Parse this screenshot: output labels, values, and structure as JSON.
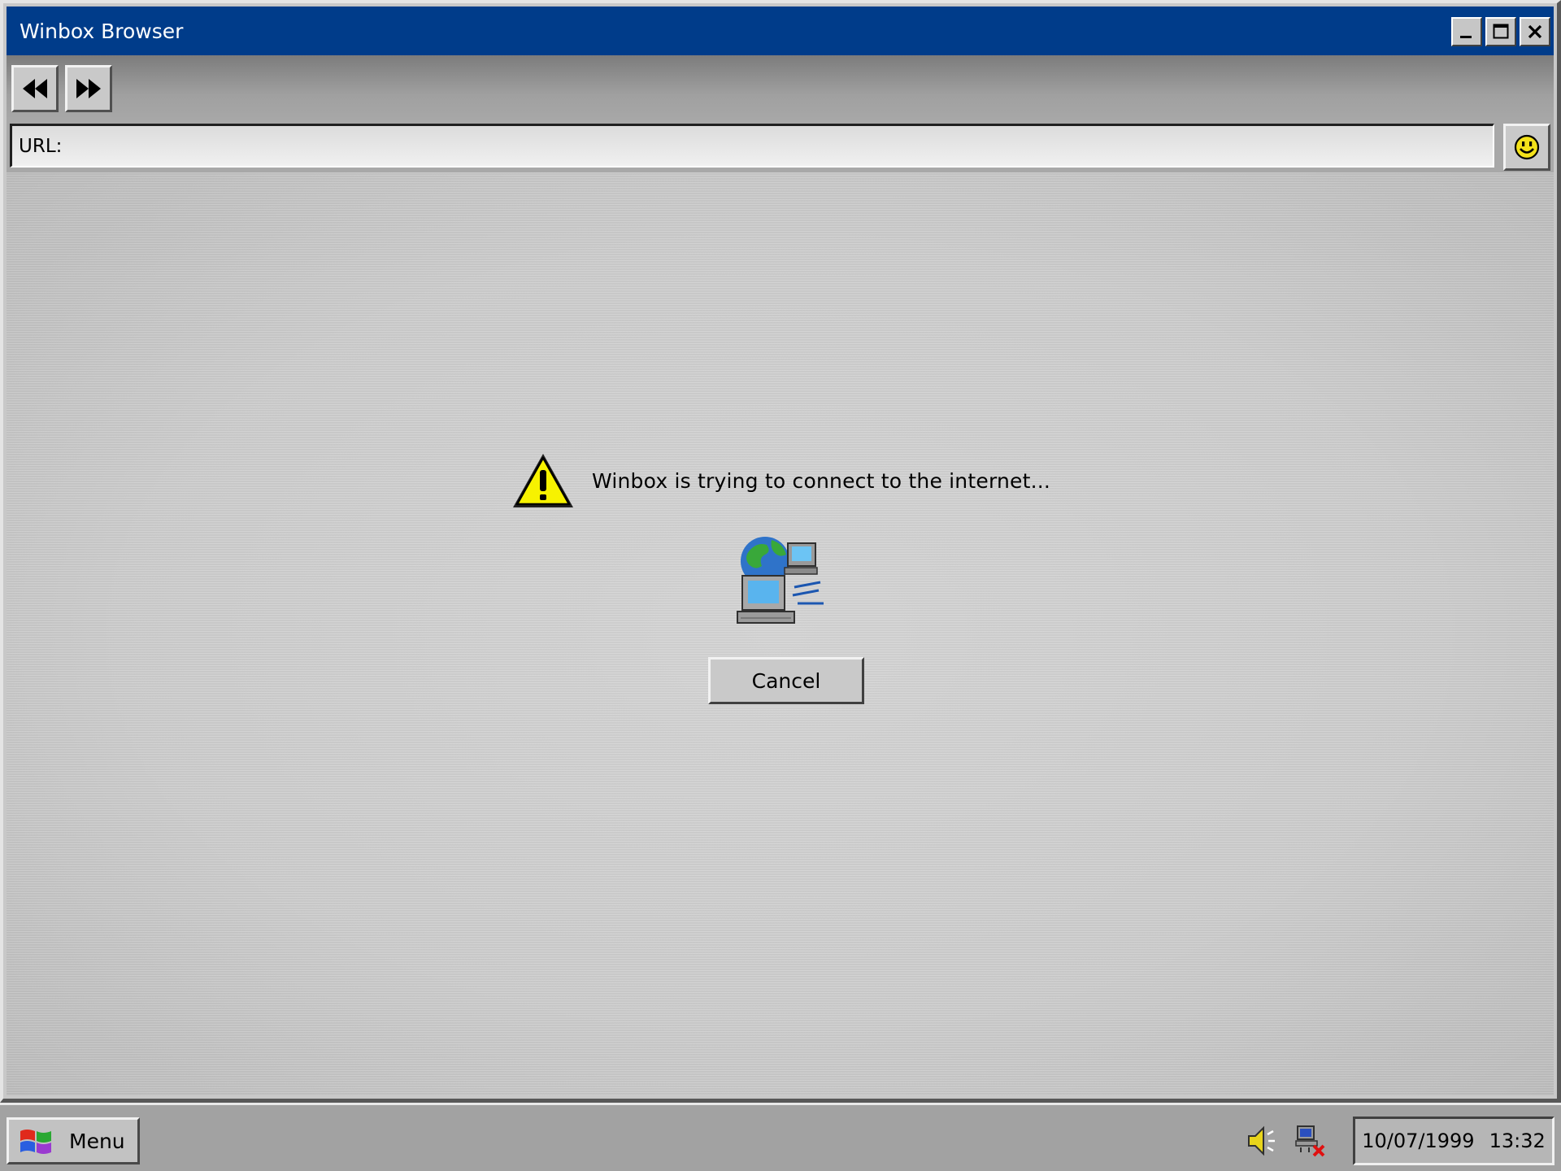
{
  "window": {
    "title": "Winbox Browser",
    "titlebar_color": "#003c8a",
    "controls": {
      "minimize_icon": "minimize-icon",
      "maximize_icon": "maximize-icon",
      "close_icon": "close-icon"
    }
  },
  "toolbar": {
    "back_icon": "rewind-icon",
    "forward_icon": "fast-forward-icon"
  },
  "address_bar": {
    "label": "URL:",
    "value": "",
    "go_icon": "smiley-icon"
  },
  "connection_dialog": {
    "message": "Winbox is trying to connect to the internet...",
    "warning_icon": "warning-icon",
    "network_icon": "network-connection-icon",
    "cancel_label": "Cancel"
  },
  "taskbar": {
    "menu_label": "Menu",
    "tray": {
      "volume_icon": "speaker-icon",
      "network_status_icon": "network-disconnected-icon"
    },
    "date": "10/07/1999",
    "time": "13:32"
  }
}
